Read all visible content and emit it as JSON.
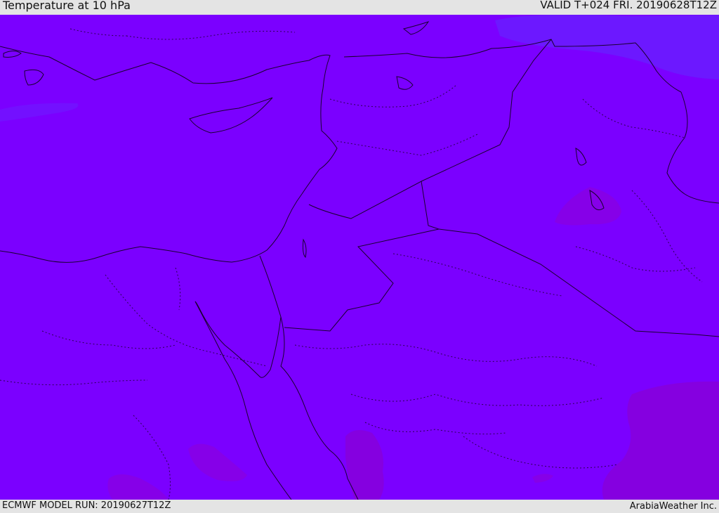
{
  "header": {
    "title": "Temperature at 10 hPa",
    "valid": "VALID T+024 FRI. 20190628T12Z"
  },
  "footer": {
    "model_run": "ECMWF MODEL RUN: 20190627T12Z",
    "credit": "ArabiaWeather Inc."
  },
  "map": {
    "field": "temperature",
    "level": "10 hPa",
    "colors": {
      "base": "#7b00ff",
      "cooler": "#6a1cff",
      "warmer": "#8a00e6",
      "border_line": "#1a0030"
    }
  }
}
